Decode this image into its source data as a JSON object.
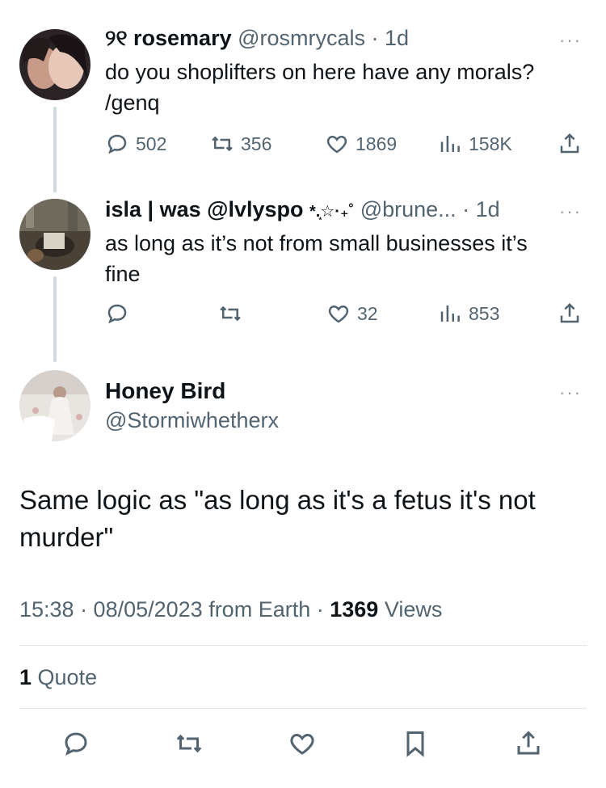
{
  "tweets": [
    {
      "name": "୨୧ rosemary",
      "handle": "@rosmrycals",
      "time": "· 1d",
      "text": "do you shoplifters on here have any morals? /genq",
      "replies": "502",
      "retweets": "356",
      "likes": "1869",
      "views": "158K"
    },
    {
      "name": "isla | was @lvlyspo",
      "decor": "*.͙☆·₊˚",
      "handle": "@brune...",
      "time": "· 1d",
      "text": "as long as it’s not from small businesses it’s fine",
      "replies": "",
      "retweets": "",
      "likes": "32",
      "views": "853"
    }
  ],
  "main": {
    "name": "Honey Bird",
    "handle": "@Stormiwhetherx",
    "text": "Same logic as \"as long as it's a fetus it's not murder\"",
    "time": "15:38 · 08/05/2023 from Earth · ",
    "views_count": "1369",
    "views_label": " Views",
    "quotes_count": "1",
    "quotes_label": " Quote"
  },
  "more_glyph": "···",
  "icons": [
    "reply-icon",
    "retweet-icon",
    "like-icon",
    "views-icon",
    "share-icon",
    "bookmark-icon",
    "more-icon"
  ]
}
